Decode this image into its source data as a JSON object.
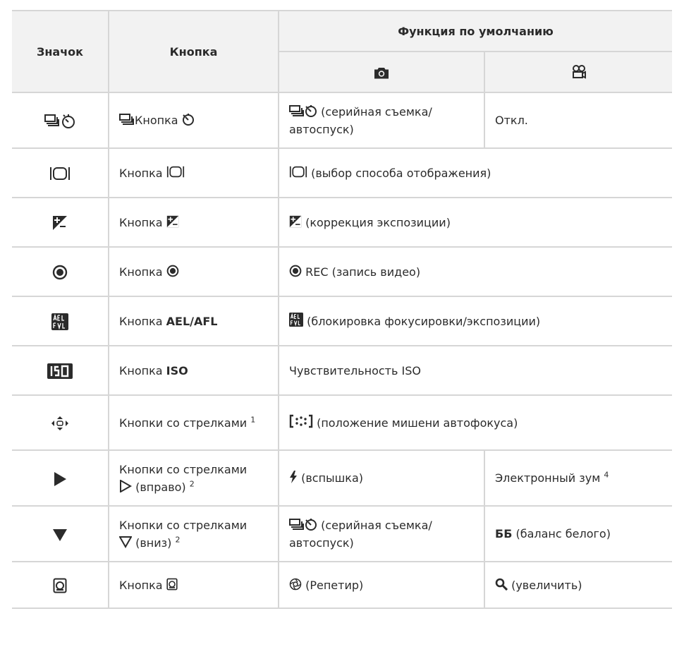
{
  "header": {
    "col_icon": "Значок",
    "col_button": "Кнопка",
    "col_function": "Функция по умолчанию",
    "sub_photo_icon": "camera-icon",
    "sub_video_icon": "movie-camera-icon"
  },
  "rows": [
    {
      "icon": "drive-selftimer-icon",
      "button": "Кнопка",
      "photo": "(серийная съемка/ автоспуск)",
      "video": "Откл."
    },
    {
      "icon": "info-display-icon",
      "button": "Кнопка",
      "photo": "(выбор способа отображения)"
    },
    {
      "icon": "exposure-compensation-icon",
      "button": "Кнопка",
      "photo": "(коррекция экспозиции)"
    },
    {
      "icon": "record-icon",
      "button": "Кнопка",
      "photo": "REC (запись видео)"
    },
    {
      "icon": "ael-afl-icon",
      "button_prefix": "Кнопка",
      "button_bold": "AEL/AFL",
      "photo": "(блокировка фокусировки/экспозиции)"
    },
    {
      "icon": "iso-icon",
      "button_prefix": "Кнопка",
      "button_bold": "ISO",
      "photo": "Чувствительность ISO"
    },
    {
      "icon": "arrow-pad-icon",
      "button": "Кнопки со стрелками",
      "button_sup": "1",
      "photo": "(положение мишени автофокуса)"
    },
    {
      "icon": "right-arrow-icon",
      "button": "Кнопки со стрелками",
      "button_line2": "(вправо)",
      "button_sup": "2",
      "photo": "(вспышка)",
      "video": "Электронный зум",
      "video_sup": "4"
    },
    {
      "icon": "down-arrow-icon",
      "button": "Кнопки со стрелками",
      "button_line2": "(вниз)",
      "button_sup": "2",
      "photo": "(серийная съемка/ автоспуск)",
      "video_bold": "ББ",
      "video": "(баланс белого)"
    },
    {
      "icon": "bracket-button-icon",
      "button": "Кнопка",
      "photo": "(Репетир)",
      "video": "(увеличить)"
    }
  ]
}
